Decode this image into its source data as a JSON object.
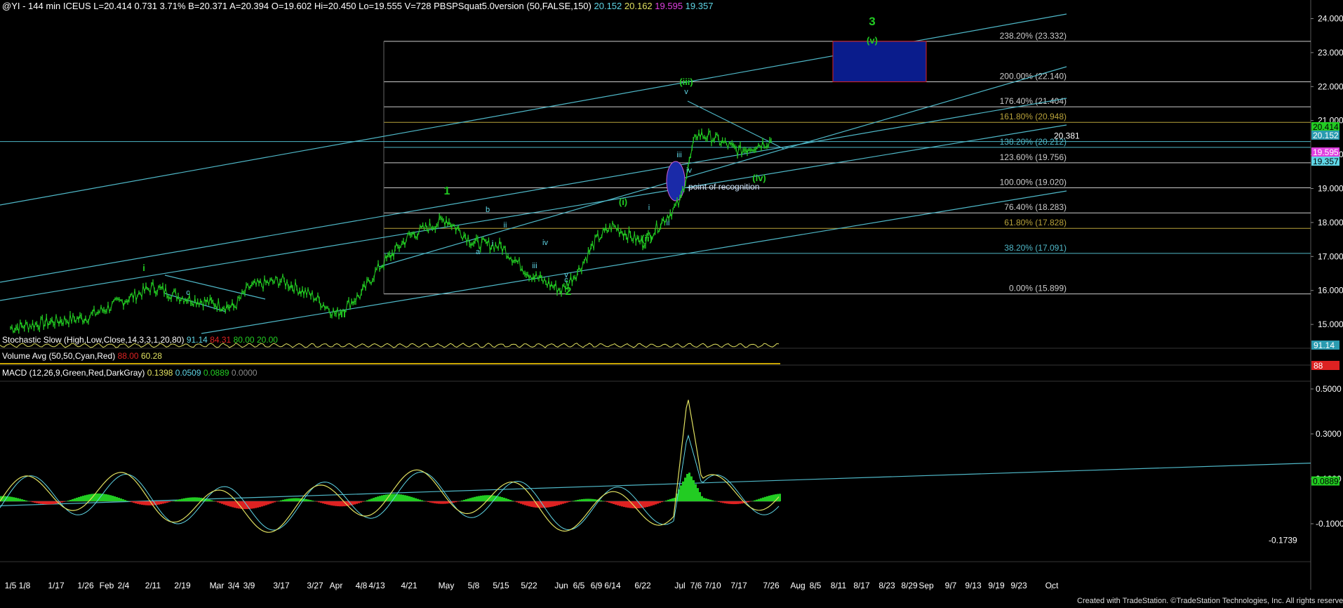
{
  "header": {
    "symbol": "@YI - 144 min ICEUS",
    "last": "L=20.414",
    "change": "0.731",
    "change_pct": "3.71%",
    "bid": "B=20.371",
    "ask": "A=20.394",
    "open": "O=19.602",
    "high": "Hi=20.450",
    "low": "Lo=19.555",
    "volume": "V=728",
    "indicator": "PBSPSquat5.0version (50,FALSE,150)",
    "ind_values": [
      "20.152",
      "20.162",
      "19.595",
      "19.357"
    ]
  },
  "indicators": {
    "stoch_label": "Stochastic Slow (High,Low,Close,14,3,3,1,20,80)",
    "stoch_values": [
      "91.14",
      "84.31",
      "80.00",
      "20.00"
    ],
    "vol_label": "Volume Avg (50,50,Cyan,Red)",
    "vol_values": [
      "88.00",
      "60.28"
    ],
    "macd_label": "MACD (12,26,9,Green,Red,DarkGray)",
    "macd_values": [
      "0.1398",
      "0.0509",
      "0.0889",
      "0.0000"
    ]
  },
  "chart_data": {
    "type": "line",
    "title": "@YI - 144 min ICEUS",
    "y_axis": {
      "min": 14.3,
      "max": 24.3,
      "ticks": [
        "24.000",
        "23.000",
        "22.000",
        "21.000",
        "20.000",
        "19.000",
        "18.000",
        "17.000",
        "16.000",
        "15.000"
      ]
    },
    "x_axis_labels": [
      "1/5",
      "1/8",
      "1/17",
      "1/26",
      "Feb",
      "2/4",
      "2/11",
      "2/19",
      "Mar",
      "3/4",
      "3/9",
      "3/17",
      "3/27",
      "Apr",
      "4/8",
      "4/13",
      "4/21",
      "May",
      "5/8",
      "5/15",
      "5/22",
      "Jun",
      "6/5",
      "6/9",
      "6/14",
      "6/22",
      "Jul",
      "7/6",
      "7/10",
      "7/17",
      "7/26",
      "Aug",
      "8/5",
      "8/11",
      "8/17",
      "8/23",
      "8/29",
      "Sep",
      "9/7",
      "9/13",
      "9/19",
      "9/23",
      "Oct"
    ],
    "price_series": {
      "name": "price",
      "x": [
        "1/5",
        "1/17",
        "1/26",
        "2/4",
        "2/11",
        "2/19",
        "3/4",
        "3/9",
        "3/17",
        "3/27",
        "Apr",
        "4/8",
        "4/13",
        "4/21",
        "May",
        "5/8",
        "5/15",
        "5/22",
        "Jun",
        "6/5",
        "6/9",
        "6/14",
        "6/22",
        "Jul",
        "7/6",
        "7/10",
        "7/17",
        "7/26"
      ],
      "values": [
        14.9,
        15.1,
        15.2,
        15.7,
        16.1,
        15.8,
        15.5,
        16.1,
        16.3,
        15.8,
        15.3,
        15.9,
        16.6,
        17.6,
        18.1,
        17.4,
        17.3,
        16.5,
        16.0,
        16.6,
        17.5,
        17.9,
        17.4,
        18.6,
        20.6,
        20.5,
        20.1,
        20.414
      ]
    },
    "fib_levels": [
      {
        "label": "238.20% (23.332)",
        "value": 23.332,
        "color": "#cccccc"
      },
      {
        "label": "200.00% (22.140)",
        "value": 22.14,
        "color": "#cccccc"
      },
      {
        "label": "176.40% (21.404)",
        "value": 21.404,
        "color": "#cccccc"
      },
      {
        "label": "161.80% (20.948)",
        "value": 20.948,
        "color": "#b8a23a"
      },
      {
        "label": "138.20% (20.212)",
        "value": 20.212,
        "color": "#4fb8c8"
      },
      {
        "label": "123.60% (19.756)",
        "value": 19.756,
        "color": "#cccccc"
      },
      {
        "label": "100.00% (19.020)",
        "value": 19.02,
        "color": "#cccccc"
      },
      {
        "label": "76.40% (18.283)",
        "value": 18.283,
        "color": "#cccccc"
      },
      {
        "label": "61.80% (17.828)",
        "value": 17.828,
        "color": "#b8a23a"
      },
      {
        "label": "38.20% (17.091)",
        "value": 17.091,
        "color": "#4fb8c8"
      },
      {
        "label": "0.00% (15.899)",
        "value": 15.899,
        "color": "#cccccc"
      }
    ],
    "price_marker_20381": "20.381",
    "axis_badges": [
      {
        "text": "20.414",
        "bg": "#22cc22",
        "fg": "#000000"
      },
      {
        "text": "20.152",
        "bg": "#2a9bb0",
        "fg": "#ffffff"
      },
      {
        "text": "19.595",
        "bg": "#e040e0",
        "fg": "#ffffff"
      },
      {
        "text": "19.357",
        "bg": "#5fd6e6",
        "fg": "#000000"
      }
    ],
    "wave_labels": [
      {
        "text": "3",
        "color": "#22cc22"
      },
      {
        "text": "(v)",
        "color": "#22cc22"
      },
      {
        "text": "(iii)",
        "color": "#22cc22"
      },
      {
        "text": "v",
        "color": "#5fd6e6"
      },
      {
        "text": "1",
        "color": "#22cc22"
      },
      {
        "text": "(i)",
        "color": "#22cc22"
      },
      {
        "text": "(ii)",
        "color": "#22cc22"
      },
      {
        "text": "(iv)",
        "color": "#22cc22"
      },
      {
        "text": "2",
        "color": "#22cc22"
      },
      {
        "text": "i",
        "color": "#22cc22"
      },
      {
        "text": "ii",
        "color": "#22cc22"
      },
      {
        "text": "iii",
        "color": "#5fd6e6"
      },
      {
        "text": "iv",
        "color": "#5fd6e6"
      },
      {
        "text": "i",
        "color": "#5fd6e6"
      },
      {
        "text": "ii",
        "color": "#5fd6e6"
      },
      {
        "text": "a",
        "color": "#5fd6e6"
      },
      {
        "text": "b",
        "color": "#5fd6e6"
      },
      {
        "text": "c",
        "color": "#5fd6e6"
      },
      {
        "text": "i",
        "color": "#5fd6e6"
      },
      {
        "text": "ii",
        "color": "#5fd6e6"
      },
      {
        "text": "iii",
        "color": "#5fd6e6"
      },
      {
        "text": "iv",
        "color": "#5fd6e6"
      },
      {
        "text": "v",
        "color": "#5fd6e6"
      },
      {
        "text": "c",
        "color": "#5fd6e6"
      }
    ],
    "annotation": "point of recognition",
    "stoch_badge": {
      "text": "91.14",
      "bg": "#2a9bb0",
      "fg": "#ffffff"
    },
    "vol_badge": {
      "text": "88",
      "bg": "#dd2222",
      "fg": "#ffffff"
    },
    "macd_axis": {
      "ticks": [
        "0.5000",
        "0.3000",
        "0.1000",
        "-0.1000"
      ],
      "min_label": "-0.1739"
    },
    "macd_badge": {
      "text": "0.0889",
      "bg": "#22cc22",
      "fg": "#000000"
    }
  },
  "footer": {
    "credit": "Created with TradeStation. ©TradeStation Technologies, Inc. All rights reserved."
  },
  "colors": {
    "green": "#22cc22",
    "cyan": "#5fd6e6",
    "channel": "#4fb8c8",
    "target_box": "#0a1c8c",
    "target_border": "#dd2222",
    "oval": "#1a2aa8"
  }
}
